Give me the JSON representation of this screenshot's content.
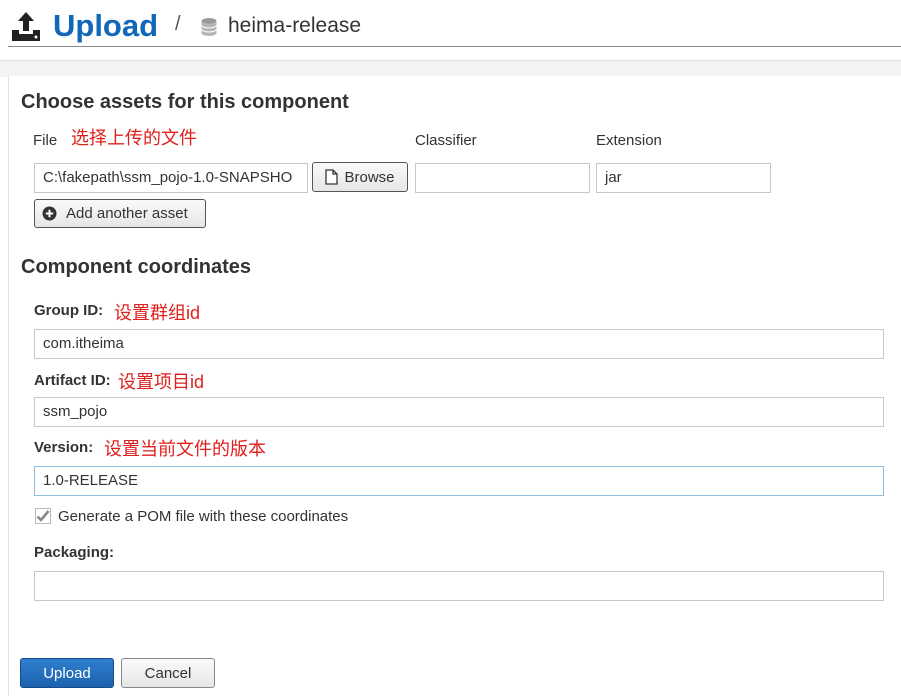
{
  "header": {
    "title": "Upload",
    "separator": "/",
    "repository": "heima-release"
  },
  "assets": {
    "section_title": "Choose assets for this component",
    "file_label": "File",
    "file_note": "选择上传的文件",
    "classifier_label": "Classifier",
    "extension_label": "Extension",
    "file_value": "C:\\fakepath\\ssm_pojo-1.0-SNAPSHO",
    "browse_label": "Browse",
    "classifier_value": "",
    "extension_value": "jar",
    "add_asset_label": "Add another asset"
  },
  "coordinates": {
    "section_title": "Component coordinates",
    "group_label": "Group ID:",
    "group_note": "设置群组id",
    "group_value": "com.itheima",
    "artifact_label": "Artifact ID:",
    "artifact_note": "设置项目id",
    "artifact_value": "ssm_pojo",
    "version_label": "Version:",
    "version_note": "设置当前文件的版本",
    "version_value": "1.0-RELEASE",
    "pom_checkbox_label": "Generate a POM file with these coordinates",
    "pom_checked": true,
    "packaging_label": "Packaging:",
    "packaging_value": ""
  },
  "actions": {
    "upload_label": "Upload",
    "cancel_label": "Cancel"
  },
  "colors": {
    "title_blue": "#1068b8",
    "note_red": "#e0201c",
    "primary_button": "#1d62ad"
  },
  "icons": [
    "upload-icon",
    "database-icon",
    "file-icon",
    "plus-circle-icon",
    "checkmark-icon"
  ]
}
